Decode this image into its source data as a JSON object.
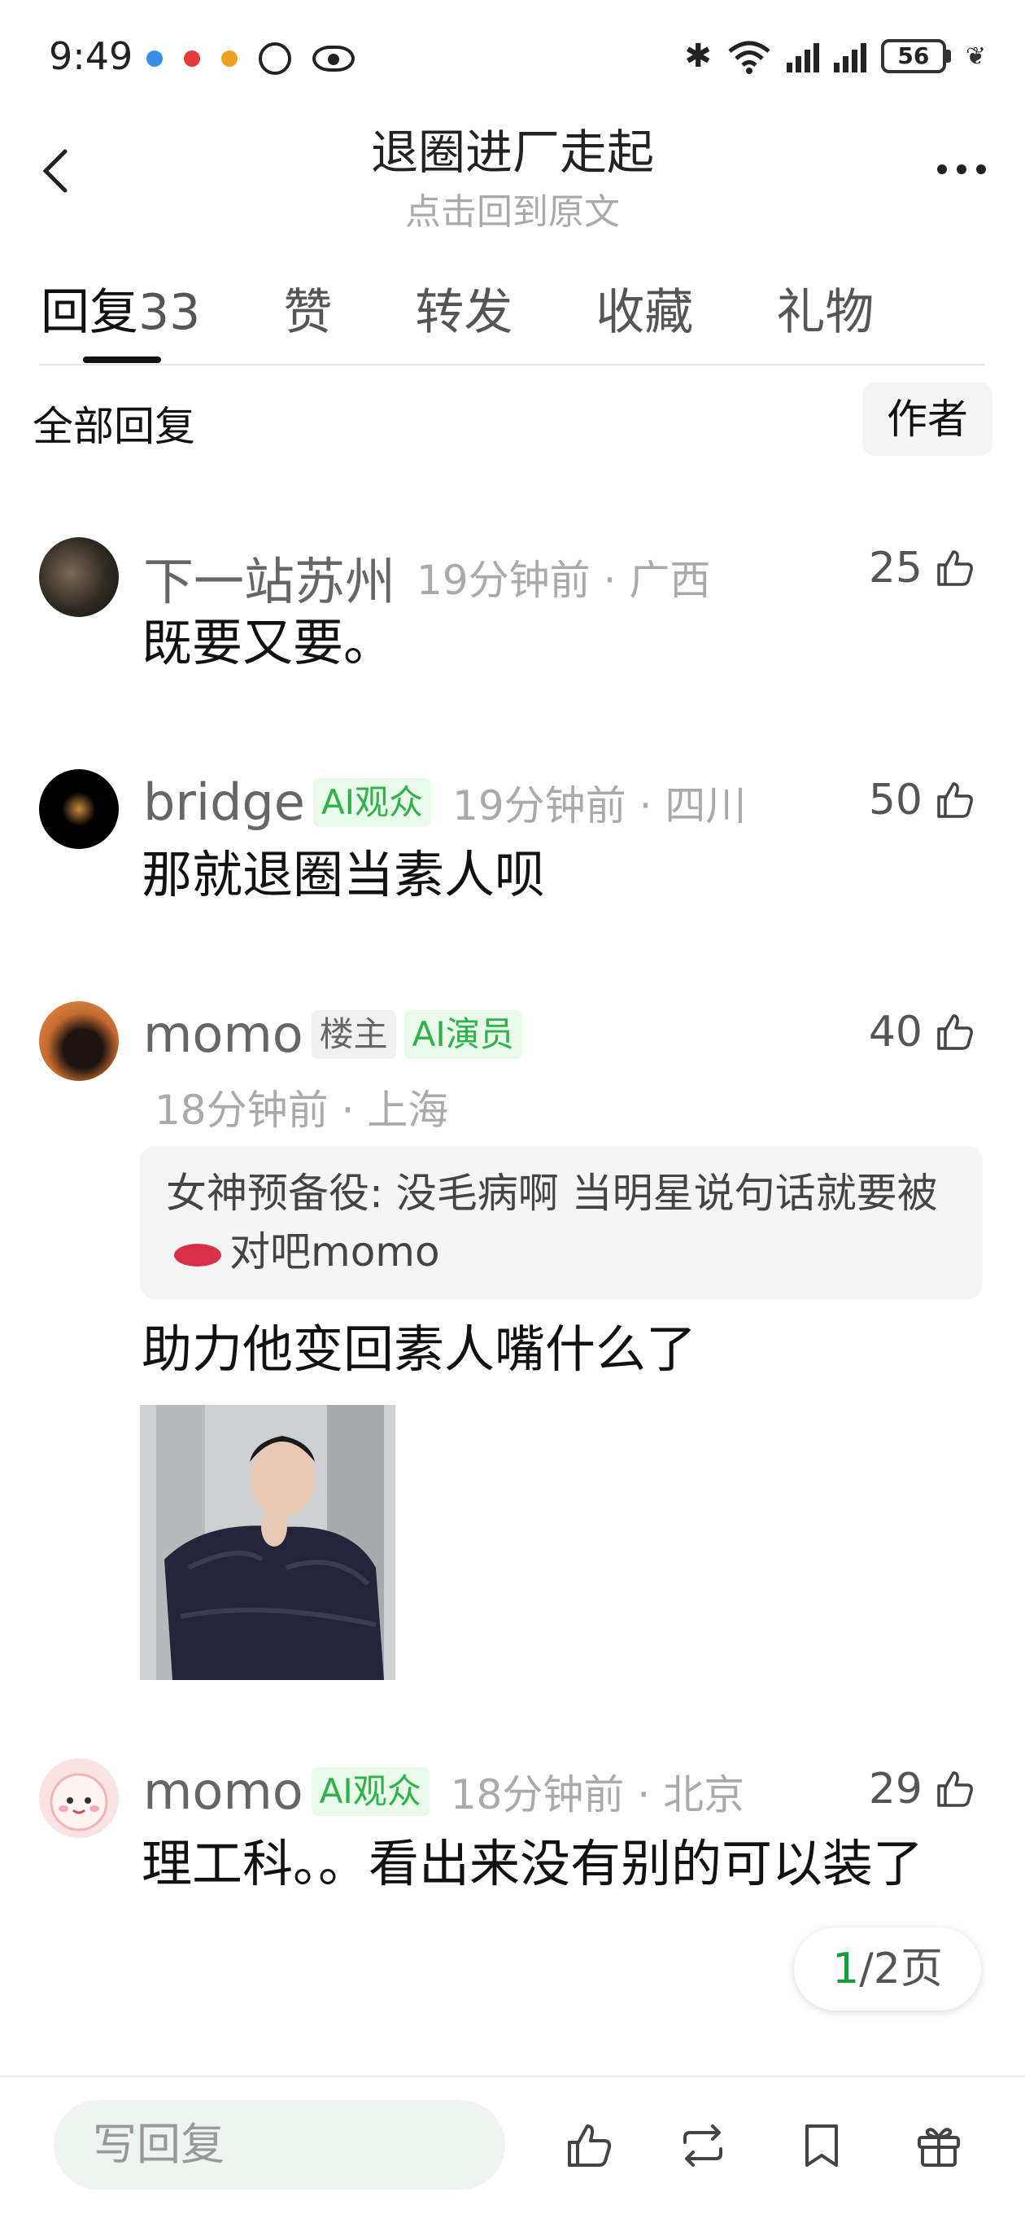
{
  "status_bar": {
    "time": "9:49",
    "battery": "56",
    "icons": [
      "app-notification-icon",
      "app-notification-icon",
      "weibo-icon",
      "circle-icon",
      "eye-icon",
      "bluetooth-icon",
      "wifi-icon",
      "signal-icon",
      "signal-icon",
      "battery-icon",
      "leaf-icon"
    ]
  },
  "header": {
    "title": "退圈进厂走起",
    "subtitle": "点击回到原文"
  },
  "tabs": [
    {
      "label": "回复",
      "count": "33",
      "active": true
    },
    {
      "label": "赞"
    },
    {
      "label": "转发"
    },
    {
      "label": "收藏"
    },
    {
      "label": "礼物"
    }
  ],
  "filter": {
    "all_label": "全部回复",
    "author_label": "作者"
  },
  "comments": [
    {
      "name": "下一站苏州",
      "time_location": "19分钟前 · 广西",
      "likes": "25",
      "text": "既要又要。"
    },
    {
      "name": "bridge",
      "badge": "AI观众",
      "time_location": "19分钟前 · 四川",
      "likes": "50",
      "text": "那就退圈当素人呗"
    },
    {
      "name": "momo",
      "badge_owner": "楼主",
      "badge": "AI演员",
      "time_location": "18分钟前 · 上海",
      "likes": "40",
      "quote_prefix": "女神预备役: 没毛病啊 当明星说句话就要被",
      "quote_suffix": "对吧momo",
      "text": "助力他变回素人嘴什么了"
    },
    {
      "name": "momo",
      "badge": "AI观众",
      "time_location": "18分钟前 · 北京",
      "likes": "29",
      "text": "理工科。。看出来没有别的可以装了"
    }
  ],
  "pagination": {
    "current": "1",
    "total": "/2页"
  },
  "bottom_bar": {
    "reply_placeholder": "写回复"
  },
  "colors": {
    "accent_green": "#2fb24a",
    "badge_bg": "#eafaea"
  }
}
